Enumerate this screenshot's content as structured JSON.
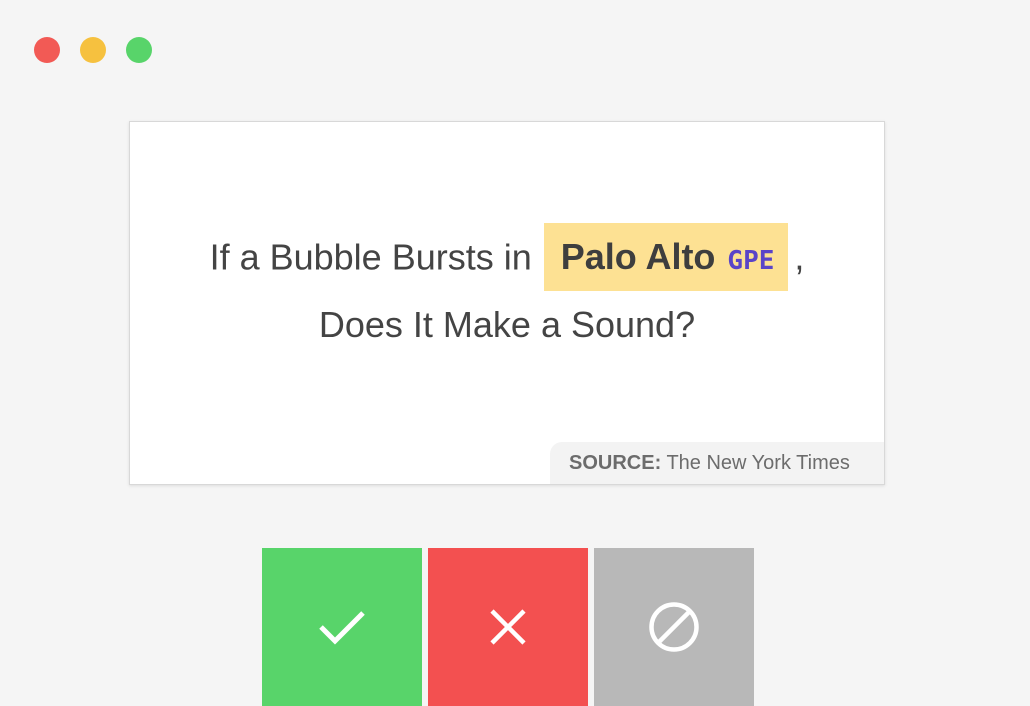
{
  "window": {
    "dots": [
      "close",
      "minimize",
      "maximize"
    ]
  },
  "card": {
    "text_before": "If a Bubble Bursts in",
    "entity": {
      "text": "Palo Alto",
      "label": "GPE"
    },
    "text_after_entity": ",",
    "line2": "Does It Make a Sound?",
    "source_key": "SOURCE:",
    "source_value": "The New York Times"
  },
  "actions": [
    {
      "name": "accept",
      "icon": "check-icon",
      "color": "#58d46a"
    },
    {
      "name": "reject",
      "icon": "close-icon",
      "color": "#f35050"
    },
    {
      "name": "ignore",
      "icon": "ban-icon",
      "color": "#b8b8b8"
    }
  ],
  "colors": {
    "background": "#f5f5f5",
    "entity_highlight": "#fde193",
    "entity_label": "#5a44c8"
  }
}
